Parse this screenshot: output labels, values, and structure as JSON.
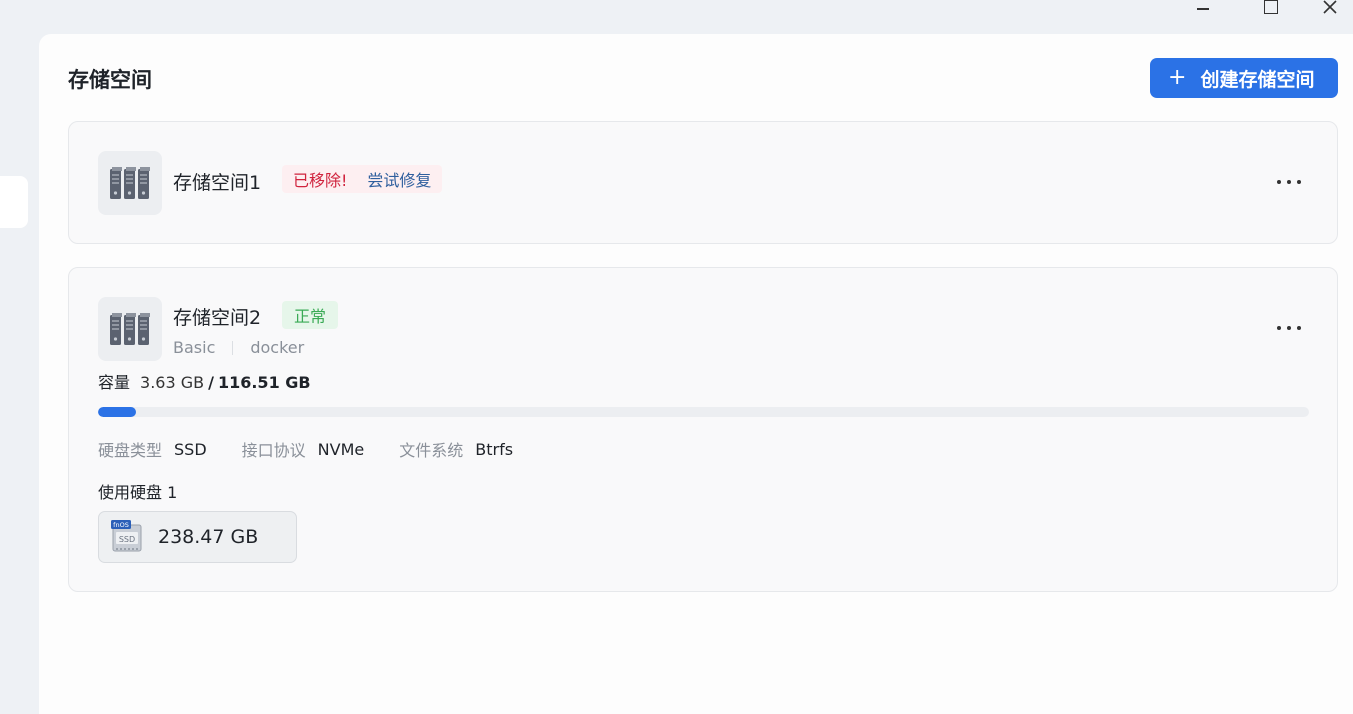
{
  "page": {
    "title": "存储空间",
    "create_label": "创建存储空间"
  },
  "volumes": [
    {
      "name": "存储空间1",
      "status_text": "已移除!",
      "repair_label": "尝试修复"
    },
    {
      "name": "存储空间2",
      "status_text": "正常",
      "raid_type": "Basic",
      "purpose": "docker",
      "capacity_label": "容量",
      "used": "3.63 GB",
      "total": "116.51 GB",
      "usage_fraction": 0.031,
      "specs": {
        "disk_type_label": "硬盘类型",
        "disk_type": "SSD",
        "interface_label": "接口协议",
        "interface": "NVMe",
        "fs_label": "文件系统",
        "fs": "Btrfs"
      },
      "disks_label": "使用硬盘 1",
      "disk_size": "238.47 GB",
      "disk_icon_text": "SSD",
      "disk_icon_brand": "fnOS"
    }
  ],
  "colors": {
    "accent": "#2b72e6",
    "error": "#d0233d",
    "ok": "#3aaa55"
  },
  "icons": [
    "minimize-icon",
    "maximize-icon",
    "close-icon",
    "storage-pool-icon",
    "more-icon",
    "plus-icon",
    "ssd-icon"
  ]
}
